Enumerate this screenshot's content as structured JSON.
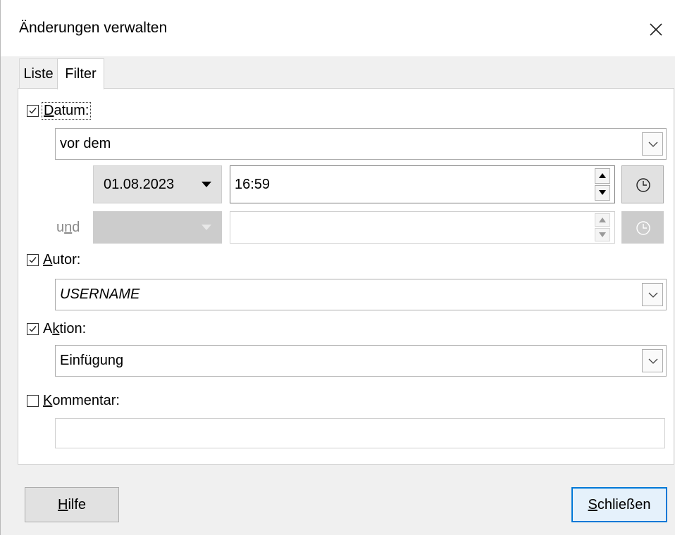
{
  "window": {
    "title": "Änderungen verwalten"
  },
  "tabs": [
    {
      "label": "Liste"
    },
    {
      "label": "Filter"
    }
  ],
  "filter": {
    "date": {
      "label_pre": "",
      "label_u": "D",
      "label_post": "atum:",
      "checked": true,
      "mode": "vor dem",
      "date_value": "01.08.2023",
      "time_value": "16:59",
      "and_label_pre": "u",
      "and_label_u": "n",
      "and_label_post": "d"
    },
    "author": {
      "label_pre": "",
      "label_u": "A",
      "label_post": "utor:",
      "checked": true,
      "value": "USERNAME"
    },
    "action": {
      "label_pre": "A",
      "label_u": "k",
      "label_post": "tion:",
      "checked": true,
      "value": "Einfügung"
    },
    "comment": {
      "label_pre": "",
      "label_u": "K",
      "label_post": "ommentar:",
      "checked": false,
      "value": ""
    }
  },
  "buttons": {
    "help_pre": "",
    "help_u": "H",
    "help_post": "ilfe",
    "close_pre": "",
    "close_u": "S",
    "close_post": "chließen"
  },
  "icons": {
    "close": "close-icon",
    "clock": "clock-icon",
    "dropdown": "chevron-down-icon",
    "spin_up": "triangle-up-icon",
    "spin_down": "triangle-down-icon"
  },
  "colors": {
    "accent": "#0078d7",
    "disabled_fill": "#cccccc"
  }
}
